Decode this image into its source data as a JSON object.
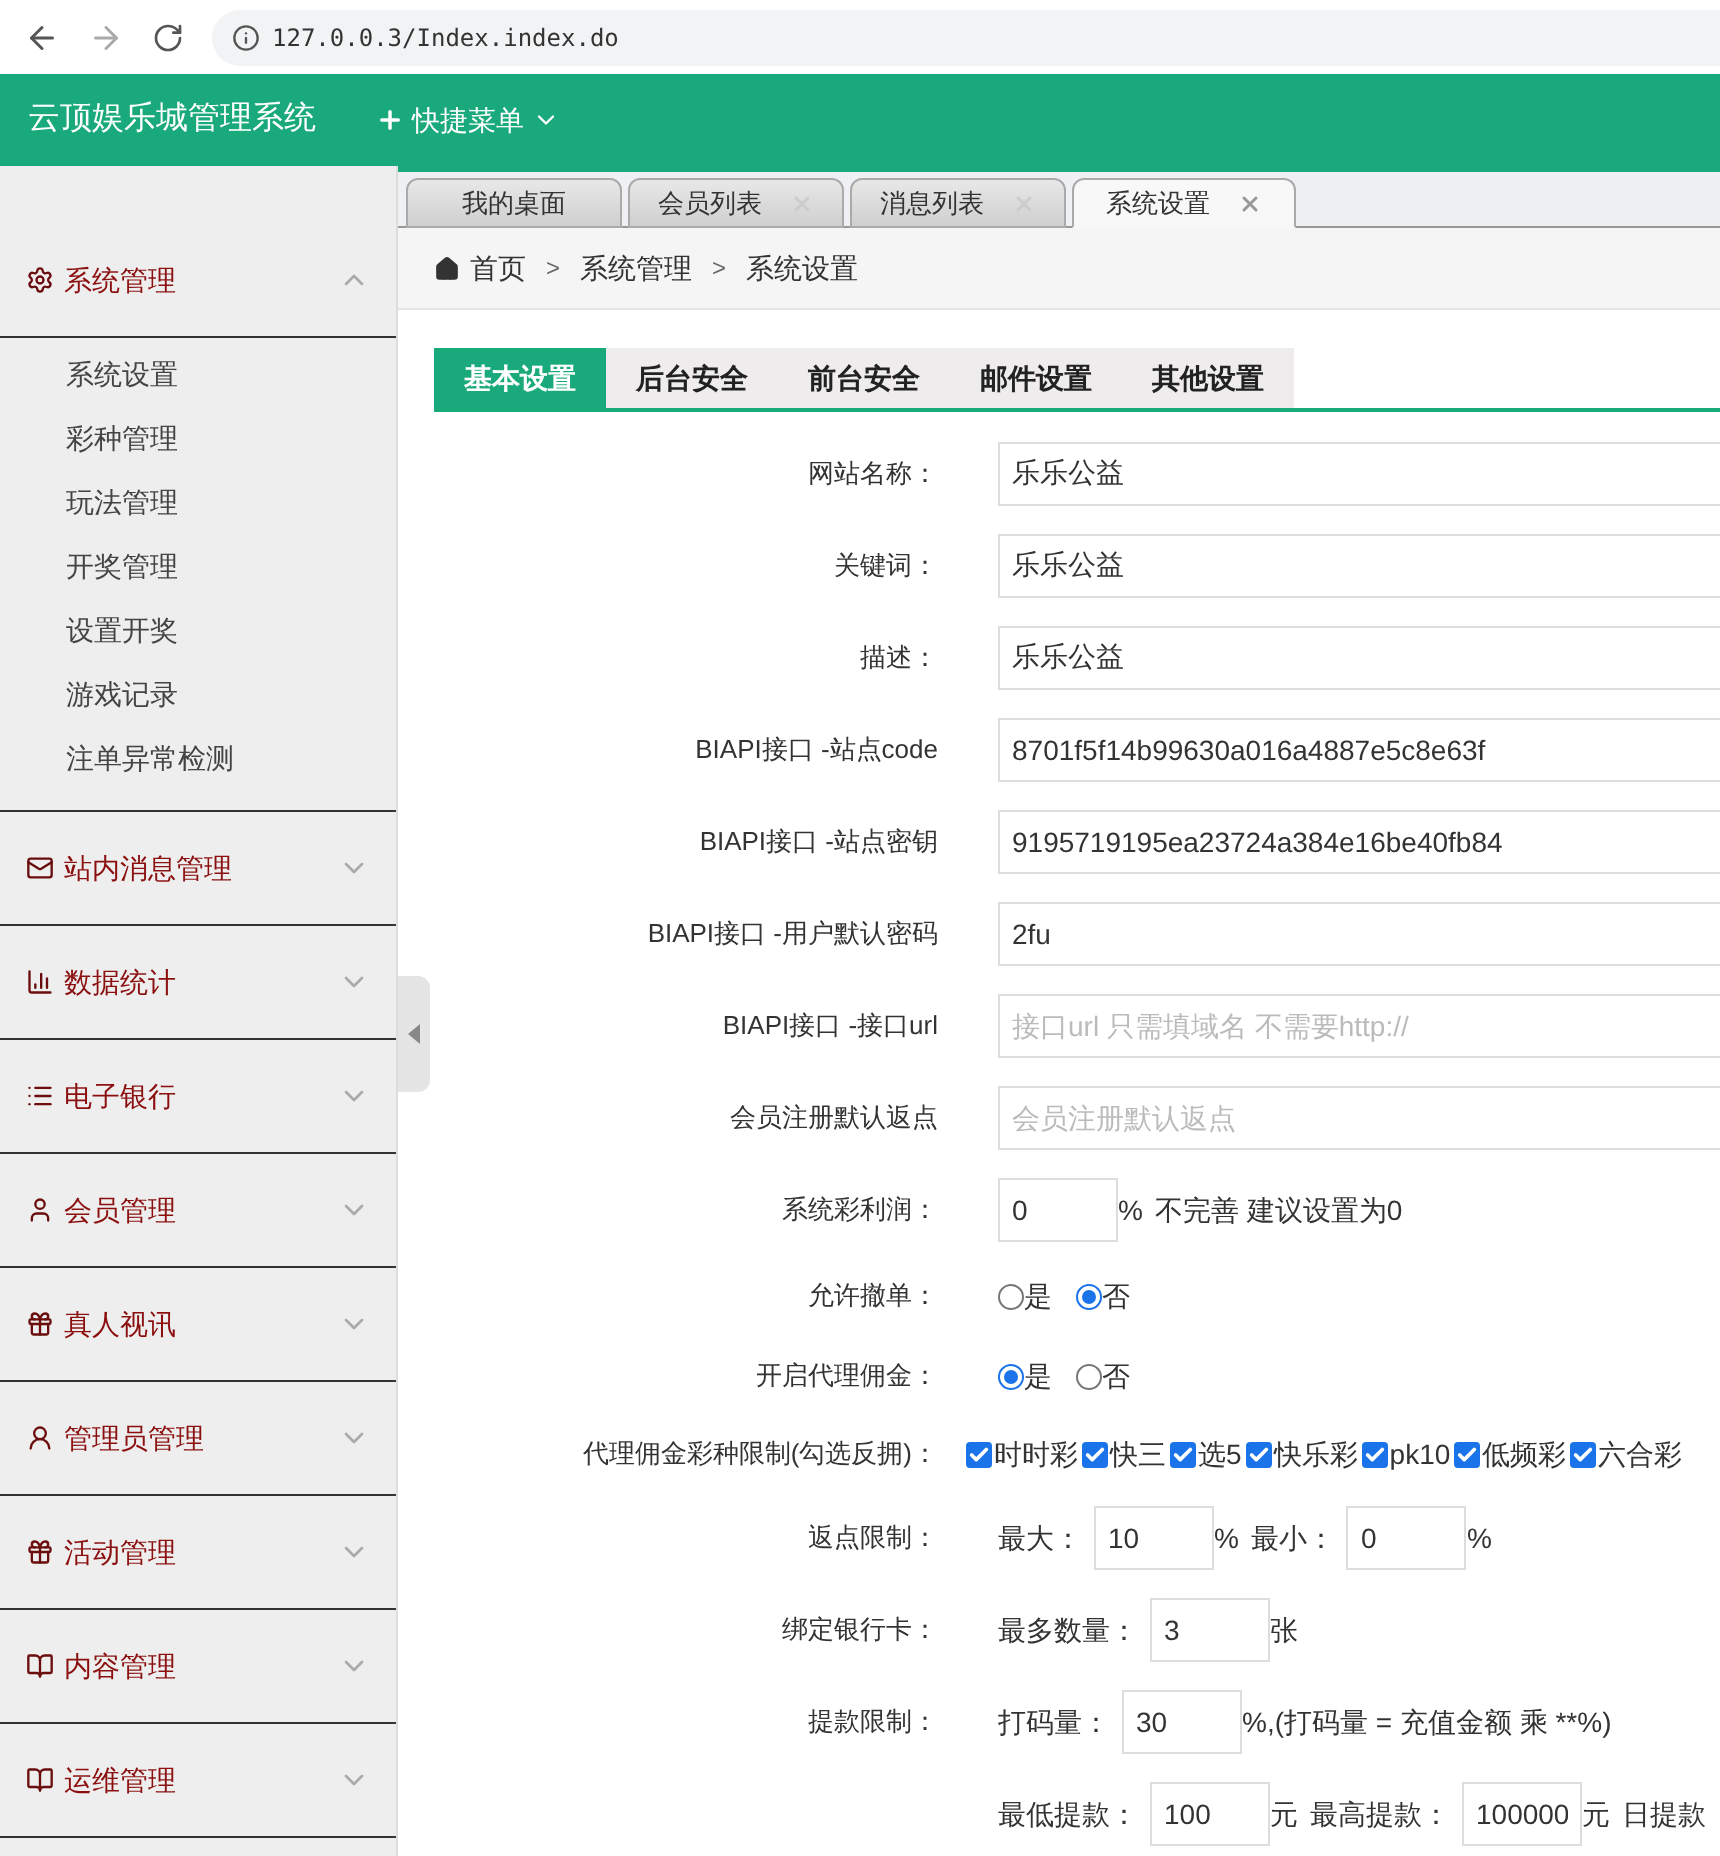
{
  "browser": {
    "url": "127.0.0.3/Index.index.do"
  },
  "header": {
    "title": "云顶娱乐城管理系统",
    "quick_menu": "快捷菜单"
  },
  "sidebar": {
    "groups": [
      {
        "label": "系统管理",
        "expanded": true,
        "children": [
          "系统设置",
          "彩种管理",
          "玩法管理",
          "开奖管理",
          "设置开奖",
          "游戏记录",
          "注单异常检测"
        ]
      },
      {
        "label": "站内消息管理",
        "expanded": false
      },
      {
        "label": "数据统计",
        "expanded": false
      },
      {
        "label": "电子银行",
        "expanded": false
      },
      {
        "label": "会员管理",
        "expanded": false
      },
      {
        "label": "真人视讯",
        "expanded": false
      },
      {
        "label": "管理员管理",
        "expanded": false
      },
      {
        "label": "活动管理",
        "expanded": false
      },
      {
        "label": "内容管理",
        "expanded": false
      },
      {
        "label": "运维管理",
        "expanded": false
      }
    ]
  },
  "tabs": [
    {
      "label": "我的桌面",
      "closable": false,
      "selected": false
    },
    {
      "label": "会员列表",
      "closable": true,
      "selected": false
    },
    {
      "label": "消息列表",
      "closable": true,
      "selected": false
    },
    {
      "label": "系统设置",
      "closable": true,
      "selected": true
    }
  ],
  "breadcrumb": [
    {
      "label": "首页"
    },
    {
      "separator": ">",
      "label": "系统管理"
    },
    {
      "separator": ">",
      "label": "系统设置"
    }
  ],
  "form_tabs": [
    {
      "label": "基本设置",
      "selected": true
    },
    {
      "label": "后台安全",
      "selected": false
    },
    {
      "label": "前台安全",
      "selected": false
    },
    {
      "label": "邮件设置",
      "selected": false
    },
    {
      "label": "其他设置",
      "selected": false
    }
  ],
  "form": [
    {
      "label": "网站名称：",
      "parts": [
        {
          "kind": "field",
          "value": "乐乐公益"
        }
      ]
    },
    {
      "label": "关键词：",
      "parts": [
        {
          "kind": "field",
          "value": "乐乐公益"
        }
      ]
    },
    {
      "label": "描述：",
      "parts": [
        {
          "kind": "field",
          "value": "乐乐公益"
        }
      ]
    },
    {
      "label": "BIAPI接口 -站点code",
      "parts": [
        {
          "kind": "field",
          "value": "8701f5f14b99630a016a4887e5c8e63f"
        }
      ]
    },
    {
      "label": "BIAPI接口 -站点密钥",
      "parts": [
        {
          "kind": "field",
          "value": "9195719195ea23724a384e16be40fb84"
        }
      ]
    },
    {
      "label": "BIAPI接口 -用户默认密码",
      "parts": [
        {
          "kind": "field",
          "value": "2fu"
        }
      ]
    },
    {
      "label": "BIAPI接口 -接口url",
      "parts": [
        {
          "kind": "field",
          "placeholder": "接口url 只需填域名 不需要http://"
        }
      ]
    },
    {
      "label": "会员注册默认返点",
      "parts": [
        {
          "kind": "field",
          "placeholder": "会员注册默认返点"
        }
      ]
    },
    {
      "label": "系统彩利润：",
      "parts": [
        {
          "kind": "box",
          "value": "0"
        },
        {
          "kind": "text",
          "text": "%"
        },
        {
          "kind": "text",
          "text": "不完善 建议设置为0"
        }
      ]
    },
    {
      "label": "允许撤单：",
      "parts": [
        {
          "kind": "radio",
          "label": "是",
          "selected": false
        },
        {
          "kind": "radio",
          "label": "否",
          "selected": true
        }
      ]
    },
    {
      "label": "开启代理佣金：",
      "parts": [
        {
          "kind": "radio",
          "label": "是",
          "selected": true
        },
        {
          "kind": "radio",
          "label": "否",
          "selected": false
        }
      ]
    },
    {
      "label": "代理佣金彩种限制(勾选反拥)：",
      "parts": [
        {
          "kind": "checkbox",
          "label": "时时彩",
          "checked": true
        },
        {
          "kind": "checkbox",
          "label": "快三",
          "checked": true
        },
        {
          "kind": "checkbox",
          "label": "选5",
          "checked": true
        },
        {
          "kind": "checkbox",
          "label": "快乐彩",
          "checked": true
        },
        {
          "kind": "checkbox",
          "label": "pk10",
          "checked": true
        },
        {
          "kind": "checkbox",
          "label": "低频彩",
          "checked": true
        },
        {
          "kind": "checkbox",
          "label": "六合彩",
          "checked": true
        }
      ]
    },
    {
      "label": "返点限制：",
      "parts": [
        {
          "kind": "text",
          "text": "最大："
        },
        {
          "kind": "box",
          "value": "10"
        },
        {
          "kind": "text",
          "text": "%"
        },
        {
          "kind": "text",
          "text": "最小："
        },
        {
          "kind": "box",
          "value": "0"
        },
        {
          "kind": "text",
          "text": "%"
        }
      ]
    },
    {
      "label": "绑定银行卡：",
      "parts": [
        {
          "kind": "text",
          "text": "最多数量："
        },
        {
          "kind": "box",
          "value": "3"
        },
        {
          "kind": "text",
          "text": "张"
        }
      ]
    },
    {
      "label": "提款限制：",
      "parts": [
        {
          "kind": "text",
          "text": "打码量："
        },
        {
          "kind": "box",
          "value": "30"
        },
        {
          "kind": "text",
          "text": "%,(打码量 = 充值金额 乘 **%)"
        }
      ]
    },
    {
      "parts": [
        {
          "kind": "text",
          "text": "最低提款："
        },
        {
          "kind": "box",
          "value": "100"
        },
        {
          "kind": "text",
          "text": "元"
        },
        {
          "kind": "text",
          "text": "最高提款："
        },
        {
          "kind": "box",
          "value": "100000"
        },
        {
          "kind": "text",
          "text": "元"
        },
        {
          "kind": "text",
          "text": "日提款"
        }
      ]
    }
  ]
}
